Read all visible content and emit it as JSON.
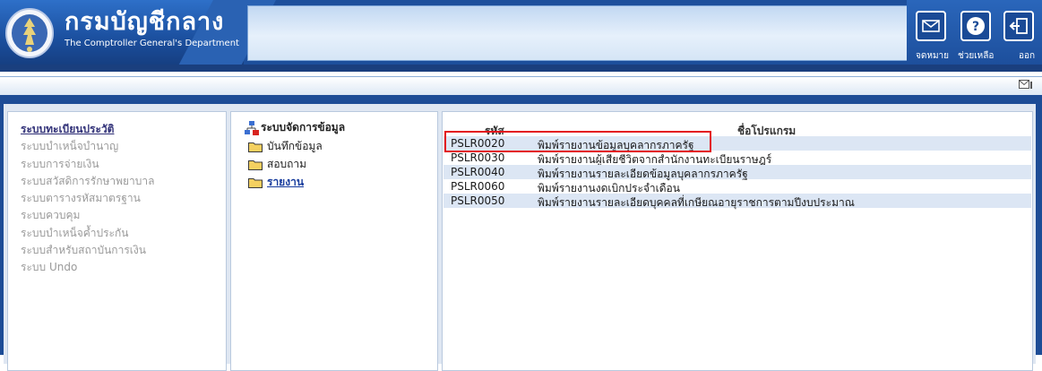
{
  "header": {
    "department_thai": "กรมบัญชีกลาง",
    "department_english": "The Comptroller General's Department",
    "buttons": [
      {
        "label": "จดหมาย",
        "icon": "envelope-icon"
      },
      {
        "label": "ช่วยเหลือ",
        "icon": "help-icon"
      },
      {
        "label": "ออก",
        "icon": "logout-icon"
      }
    ]
  },
  "toolbar": {
    "icon": "mail-small-icon"
  },
  "left_menu": {
    "items": [
      {
        "label": "ระบบทะเบียนประวัติ",
        "active": true
      },
      {
        "label": "ระบบบำเหน็จบำนาญ",
        "active": false
      },
      {
        "label": "ระบบการจ่ายเงิน",
        "active": false
      },
      {
        "label": "ระบบสวัสดิการรักษาพยาบาล",
        "active": false
      },
      {
        "label": "ระบบตารางรหัสมาตรฐาน",
        "active": false
      },
      {
        "label": "ระบบควบคุม",
        "active": false
      },
      {
        "label": "ระบบบำเหน็จค้ำประกัน",
        "active": false
      },
      {
        "label": "ระบบสำหรับสถาบันการเงิน",
        "active": false
      },
      {
        "label": "ระบบ Undo",
        "active": false
      }
    ]
  },
  "tree": {
    "root": "ระบบจัดการข้อมูล",
    "items": [
      {
        "label": "บันทึกข้อมูล",
        "active": false
      },
      {
        "label": "สอบถาม",
        "active": false
      },
      {
        "label": "รายงาน",
        "active": true
      }
    ]
  },
  "programs": {
    "headers": {
      "code": "รหัส",
      "name": "ชื่อโปรแกรม"
    },
    "rows": [
      {
        "code": "PSLR0020",
        "name": "พิมพ์รายงานข้อมูลบุคลากรภาครัฐ"
      },
      {
        "code": "PSLR0030",
        "name": "พิมพ์รายงานผู้เสียชีวิตจากสำนักงานทะเบียนราษฎร์"
      },
      {
        "code": "PSLR0040",
        "name": "พิมพ์รายงานรายละเอียดข้อมูลบุคลากรภาครัฐ"
      },
      {
        "code": "PSLR0060",
        "name": "พิมพ์รายงานงดเบิกประจำเดือน"
      },
      {
        "code": "PSLR0050",
        "name": "พิมพ์รายงานรายละเอียดบุคคลที่เกษียณอายุราชการตามปีงบประมาณ"
      }
    ]
  }
}
